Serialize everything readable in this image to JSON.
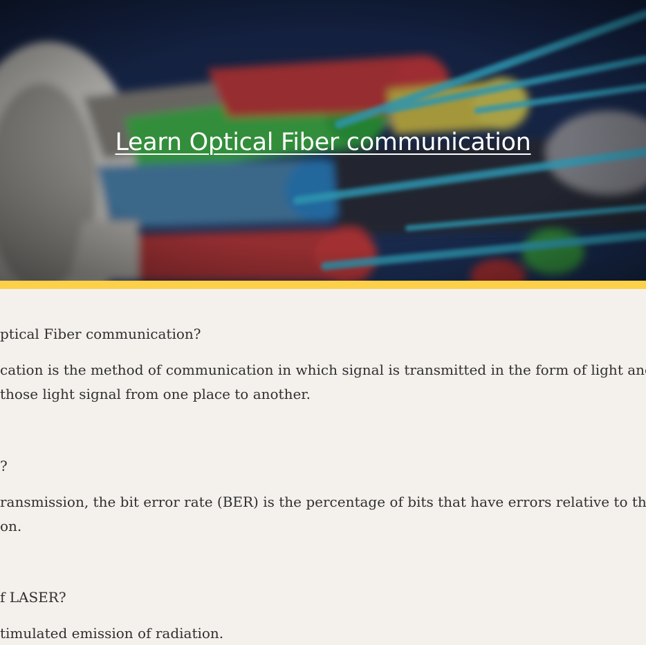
{
  "hero": {
    "title": "Learn Optical Fiber communication",
    "image": "fiber-optic-cables-image"
  },
  "faq": [
    {
      "question": "ptical Fiber communication?",
      "answer_lines": [
        "cation is the method of communication in which signal is transmitted in the form of light and",
        "those light signal from one place to another."
      ]
    },
    {
      "question": "?",
      "answer_lines": [
        "ransmission, the bit error rate (BER) is the percentage of bits that have errors relative to the to",
        "on."
      ]
    },
    {
      "question": "f LASER?",
      "answer_lines": [
        "timulated emission of radiation."
      ]
    }
  ],
  "colors": {
    "hero_bg": "#1e2d52",
    "accent": "#fdd04a",
    "page_bg": "#f4f1ed",
    "text": "#2f2f2f"
  }
}
